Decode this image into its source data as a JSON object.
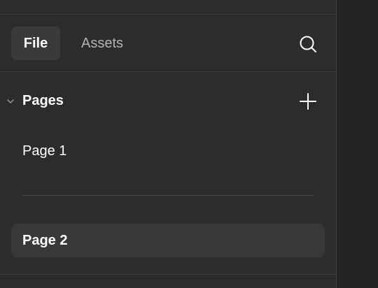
{
  "tabs": [
    {
      "label": "File",
      "active": true
    },
    {
      "label": "Assets",
      "active": false
    }
  ],
  "search": {
    "icon": "search-icon"
  },
  "pages_section": {
    "title": "Pages",
    "expanded": true,
    "add_icon": "plus-icon"
  },
  "pages": [
    {
      "label": "Page 1",
      "selected": false
    },
    {
      "label": "Page 2",
      "selected": true
    }
  ],
  "colors": {
    "panel_bg": "#2c2c2c",
    "canvas_bg": "#242424",
    "active_tab_bg": "#3a3a3a",
    "selected_row_bg": "#383838",
    "text_primary": "#ffffff",
    "text_secondary": "#b3b3b3"
  }
}
